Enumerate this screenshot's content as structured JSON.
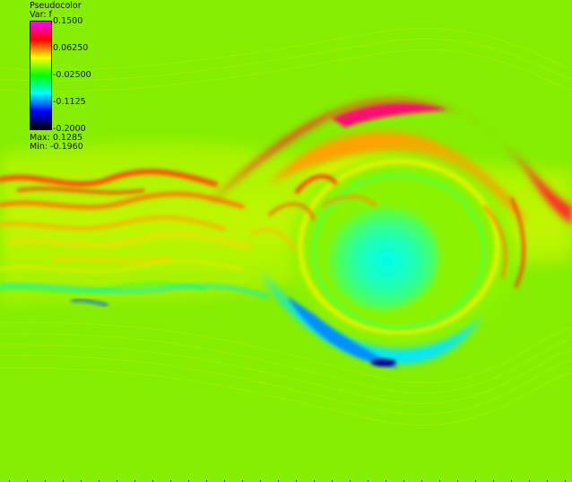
{
  "legend": {
    "title": "Pseudocolor",
    "variable": "Var: f",
    "ticks": [
      "0.1500",
      "0.06250",
      "-0.02500",
      "-0.1125",
      "-0.2000"
    ],
    "max_label": "Max:  0.1285",
    "min_label": "Min: -0.1960",
    "colormap": [
      "#ff00ff",
      "#ff0000",
      "#ffff00",
      "#00ff00",
      "#00ffff",
      "#0000ff",
      "#000000"
    ]
  },
  "field": {
    "variable": "f",
    "range": [
      -0.2,
      0.15
    ],
    "max": 0.1285,
    "min": -0.196,
    "colors": {
      "background": "#88f000",
      "shear_layer": "#c8f800",
      "positive_peak": "#ff1a4a",
      "red": "#ff3a00",
      "orange": "#ffa000",
      "yellow": "#f0f000",
      "green": "#40ff20",
      "cyan": "#00ffe8",
      "blue": "#0090ff",
      "dark_blue": "#000090"
    }
  }
}
